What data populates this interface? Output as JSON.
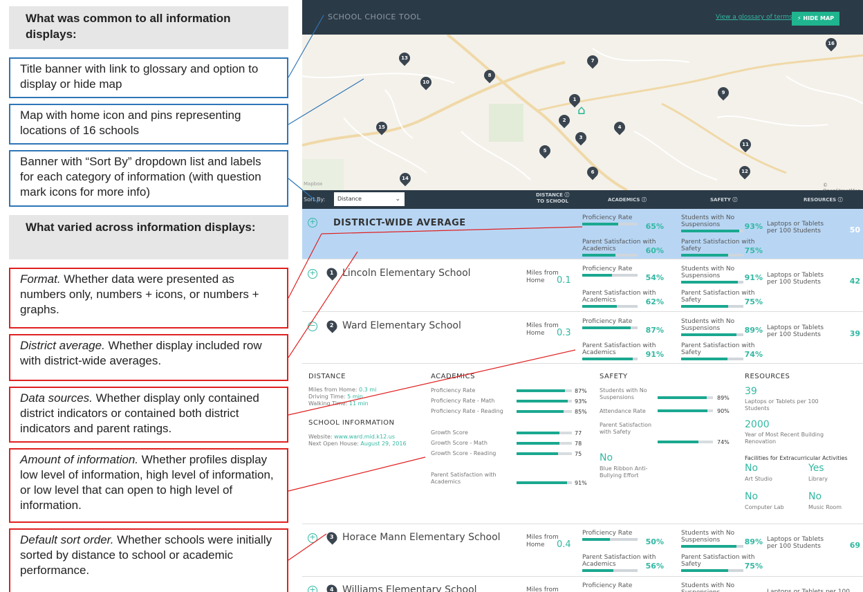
{
  "left": {
    "common_header": "What was common to all information displays:",
    "common_items": [
      "Title banner with link to glossary and option to display or hide map",
      "Map with home icon and pins representing locations of 16 schools",
      "Banner with “Sort By” dropdown list and labels for each category of information (with question mark icons for more info)"
    ],
    "varied_header": "What varied across information displays:",
    "varied_items": [
      {
        "title": "Format.",
        "text": " Whether data were presented as numbers only, numbers + icons, or numbers + graphs."
      },
      {
        "title": "District average.",
        "text": " Whether display included row with district-wide averages."
      },
      {
        "title": "Data sources.",
        "text": " Whether display only contained district indicators or contained both district indicators and parent ratings."
      },
      {
        "title": "Amount of information.",
        "text": " Whether profiles display low level of information, high level of information, or low level that can open to high level of information."
      },
      {
        "title": "Default sort order.",
        "text": " Whether schools were initially sorted by distance to school or academic performance."
      }
    ]
  },
  "app": {
    "title": "SCHOOL CHOICE TOOL",
    "glossary_link": "View a glossary of terms",
    "hide_map": "HIDE MAP",
    "map_credit_left": "Mapbox",
    "map_credit_right": "© OpenStreetMap",
    "pins": [
      "1",
      "2",
      "3",
      "4",
      "5",
      "6",
      "7",
      "8",
      "9",
      "10",
      "11",
      "12",
      "13",
      "14",
      "15",
      "16"
    ],
    "sort_label": "Sort By:",
    "sort_value": "Distance",
    "col_distance": "DISTANCE",
    "col_distance2": "TO SCHOOL",
    "col_academics": "ACADEMICS",
    "col_safety": "SAFETY",
    "col_resources": "RESOURCES",
    "district": {
      "name": "DISTRICT-WIDE AVERAGE",
      "prof_label": "Proficiency Rate",
      "prof": "65%",
      "prof_frac": 0.65,
      "psa_label": "Parent Satisfaction with Academics",
      "psa": "60%",
      "psa_frac": 0.6,
      "susp_label": "Students with No Suspensions",
      "susp": "93%",
      "susp_frac": 0.93,
      "pss_label": "Parent Satisfaction with Safety",
      "pss": "75%",
      "pss_frac": 0.75,
      "laptops_label": "Laptops or Tablets per 100 Students",
      "laptops": "50"
    },
    "schools": [
      {
        "num": "1",
        "name": "Lincoln Elementary School",
        "miles_label": "Miles from Home",
        "miles": "0.1",
        "prof": "54%",
        "prof_frac": 0.54,
        "psa": "62%",
        "psa_frac": 0.62,
        "susp": "91%",
        "susp_frac": 0.91,
        "pss": "75%",
        "pss_frac": 0.75,
        "laptops": "42"
      },
      {
        "num": "2",
        "name": "Ward Elementary School",
        "miles_label": "Miles from Home",
        "miles": "0.3",
        "prof": "87%",
        "prof_frac": 0.87,
        "psa": "91%",
        "psa_frac": 0.91,
        "susp": "89%",
        "susp_frac": 0.89,
        "pss": "74%",
        "pss_frac": 0.74,
        "laptops": "39"
      },
      {
        "num": "3",
        "name": "Horace Mann Elementary School",
        "miles_label": "Miles from Home",
        "miles": "0.4",
        "prof": "50%",
        "prof_frac": 0.5,
        "psa": "56%",
        "psa_frac": 0.56,
        "susp": "89%",
        "susp_frac": 0.89,
        "pss": "75%",
        "pss_frac": 0.75,
        "laptops": "69"
      },
      {
        "num": "4",
        "name": "Williams Elementary School",
        "miles_label": "Miles from",
        "prof": "",
        "psa": "",
        "susp": "",
        "pss": "",
        "laptops": ""
      }
    ],
    "metric_labels": {
      "prof": "Proficiency Rate",
      "psa": "Parent Satisfaction with Academics",
      "susp": "Students with No Suspensions",
      "pss": "Parent Satisfaction with Safety",
      "laptops": "Laptops or Tablets per 100 Students"
    },
    "detail": {
      "distance_h": "DISTANCE",
      "miles_home": "Miles from Home: ",
      "miles_home_v": "0.3 mi",
      "driving": "Driving Time: ",
      "driving_v": "5 min",
      "walking": "Walking Time: ",
      "walking_v": "11 min",
      "school_info_h": "SCHOOL INFORMATION",
      "website": "Website: ",
      "website_v": "www.ward.mid.k12.us",
      "open_house": "Next Open House: ",
      "open_house_v": "August 29, 2016",
      "academics_h": "ACADEMICS",
      "academics": [
        {
          "label": "Proficiency Rate",
          "v": "87%",
          "f": 0.87
        },
        {
          "label": "Proficiency Rate - Math",
          "v": "93%",
          "f": 0.93
        },
        {
          "label": "Proficiency Rate - Reading",
          "v": "85%",
          "f": 0.85
        },
        {
          "label": "Growth Score",
          "v": "77",
          "f": 0.77
        },
        {
          "label": "Growth Score - Math",
          "v": "78",
          "f": 0.78
        },
        {
          "label": "Growth Score - Reading",
          "v": "75",
          "f": 0.75
        },
        {
          "label": "Parent Satisfaction with Academics",
          "v": "91%",
          "f": 0.91
        }
      ],
      "safety_h": "SAFETY",
      "safety": [
        {
          "label": "Students with No Suspensions",
          "v": "89%",
          "f": 0.89
        },
        {
          "label": "Attendance Rate",
          "v": "90%",
          "f": 0.9
        },
        {
          "label": "Parent Satisfaction with Safety",
          "v": "74%",
          "f": 0.74
        }
      ],
      "blue_ribbon_v": "No",
      "blue_ribbon": "Blue Ribbon Anti-Bullying Effort",
      "resources_h": "RESOURCES",
      "laptops_v": "39",
      "laptops": "Laptops or Tablets per 100 Students",
      "building_v": "2000",
      "building": "Year of Most Recent Building Renovation",
      "facilities_h": "Facilities for Extracurricular Activities",
      "facilities": [
        {
          "v": "No",
          "label": "Art Studio"
        },
        {
          "v": "Yes",
          "label": "Library"
        },
        {
          "v": "No",
          "label": "Computer Lab"
        },
        {
          "v": "No",
          "label": "Music Room"
        }
      ]
    }
  }
}
